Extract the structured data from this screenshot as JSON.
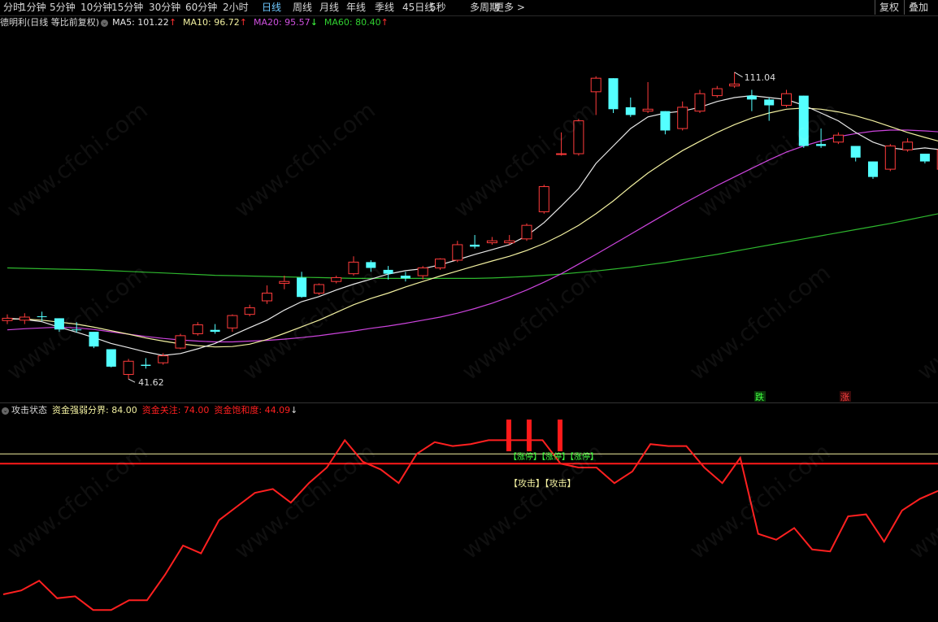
{
  "toolbar": {
    "tabs": [
      "分时",
      "1分钟",
      "5分钟",
      "10分钟",
      "15分钟",
      "30分钟",
      "60分钟",
      "2小时",
      "日线",
      "周线",
      "月线",
      "年线",
      "季线",
      "45日线",
      "5秒",
      "多周期",
      "更多 >"
    ],
    "active_tab": "日线",
    "right_buttons": [
      "复权",
      "叠加"
    ]
  },
  "main_legend": {
    "title": "德明利(日线 等比前复权)",
    "items": [
      {
        "label": "MA5: 101.22",
        "arrow": "↑",
        "color": "#e8e8e8",
        "arrow_color": "#ff3030"
      },
      {
        "label": "MA10: 96.72",
        "arrow": "↑",
        "color": "#f2f0a0",
        "arrow_color": "#ff3030"
      },
      {
        "label": "MA20: 95.57",
        "arrow": "↓",
        "color": "#d050e0",
        "arrow_color": "#40ff40"
      },
      {
        "label": "MA60: 80.40",
        "arrow": "↑",
        "color": "#30d030",
        "arrow_color": "#ff3030"
      }
    ]
  },
  "price_annotations": {
    "high": "111.04",
    "low": "41.62"
  },
  "signals": {
    "fall": "跌",
    "rise": "涨"
  },
  "sub_legend": {
    "title": "攻击状态",
    "items": [
      {
        "label": "资金强弱分界: 84.00",
        "color": "#f2f0a0"
      },
      {
        "label": "资金关注: 74.00",
        "color": "#ff2020"
      },
      {
        "label": "资金饱和度: 44.09",
        "color": "#ff2020"
      }
    ],
    "tail_arrow": "↓"
  },
  "sub_annotations": {
    "limit_up": "【涨停】【涨停】【涨停】",
    "attack": "【攻击】【攻击】"
  },
  "watermark": "www.cfchi.com",
  "colors": {
    "up": "#ff3b3b",
    "down": "#54ffff",
    "ma5": "#e8e8e8",
    "ma10": "#f2f0a0",
    "ma20": "#cc44dd",
    "ma60": "#2eb82e",
    "line": "#ff2020",
    "threshold_yellow": "#f2f0a0",
    "threshold_red": "#ff1a1a"
  },
  "chart_data": {
    "type": "candlestick",
    "title": "德明利(日线 等比前复权)",
    "candles": [
      {
        "o": 46.9,
        "h": 48.5,
        "l": 46.0,
        "c": 47.5
      },
      {
        "o": 47.0,
        "h": 48.8,
        "l": 46.0,
        "c": 47.8
      },
      {
        "o": 48.0,
        "h": 49.2,
        "l": 46.8,
        "c": 47.9
      },
      {
        "o": 47.5,
        "h": 47.5,
        "l": 44.0,
        "c": 44.6
      },
      {
        "o": 44.6,
        "h": 46.5,
        "l": 43.8,
        "c": 44.4
      },
      {
        "o": 44.0,
        "h": 44.0,
        "l": 39.8,
        "c": 40.2
      },
      {
        "o": 39.5,
        "h": 39.5,
        "l": 34.8,
        "c": 35.0
      },
      {
        "o": 33.0,
        "h": 37.0,
        "l": 31.8,
        "c": 36.4
      },
      {
        "o": 35.5,
        "h": 37.2,
        "l": 34.5,
        "c": 35.2
      },
      {
        "o": 36.0,
        "h": 38.5,
        "l": 35.5,
        "c": 37.8
      },
      {
        "o": 39.8,
        "h": 43.5,
        "l": 39.5,
        "c": 43.0
      },
      {
        "o": 43.5,
        "h": 46.5,
        "l": 43.0,
        "c": 45.8
      },
      {
        "o": 44.5,
        "h": 46.0,
        "l": 43.5,
        "c": 44.0
      },
      {
        "o": 45.0,
        "h": 48.5,
        "l": 44.0,
        "c": 48.2
      },
      {
        "o": 48.5,
        "h": 51.0,
        "l": 48.0,
        "c": 50.2
      },
      {
        "o": 52.0,
        "h": 56.0,
        "l": 51.2,
        "c": 54.0
      },
      {
        "o": 56.5,
        "h": 58.5,
        "l": 55.0,
        "c": 57.0
      },
      {
        "o": 58.0,
        "h": 59.5,
        "l": 52.8,
        "c": 53.0
      },
      {
        "o": 54.0,
        "h": 56.5,
        "l": 53.5,
        "c": 56.2
      },
      {
        "o": 57.0,
        "h": 58.5,
        "l": 56.5,
        "c": 58.0
      },
      {
        "o": 59.0,
        "h": 63.5,
        "l": 58.5,
        "c": 62.0
      },
      {
        "o": 62.0,
        "h": 62.5,
        "l": 59.5,
        "c": 60.5
      },
      {
        "o": 60.0,
        "h": 61.0,
        "l": 57.5,
        "c": 59.0
      },
      {
        "o": 58.5,
        "h": 59.5,
        "l": 57.0,
        "c": 57.8
      },
      {
        "o": 58.5,
        "h": 61.0,
        "l": 57.5,
        "c": 60.5
      },
      {
        "o": 60.5,
        "h": 63.0,
        "l": 60.0,
        "c": 62.8
      },
      {
        "o": 62.5,
        "h": 67.5,
        "l": 62.0,
        "c": 66.5
      },
      {
        "o": 66.5,
        "h": 69.0,
        "l": 65.5,
        "c": 66.0
      },
      {
        "o": 67.0,
        "h": 68.5,
        "l": 66.5,
        "c": 67.5
      },
      {
        "o": 67.0,
        "h": 69.0,
        "l": 66.5,
        "c": 67.5
      },
      {
        "o": 68.0,
        "h": 72.0,
        "l": 67.5,
        "c": 71.5
      },
      {
        "o": 75.0,
        "h": 82.0,
        "l": 74.5,
        "c": 81.5
      },
      {
        "o": 90.0,
        "h": 95.5,
        "l": 89.5,
        "c": 90.0
      },
      {
        "o": 90.0,
        "h": 99.0,
        "l": 89.5,
        "c": 98.5
      },
      {
        "o": 106.0,
        "h": 110.0,
        "l": 100.0,
        "c": 109.5
      },
      {
        "o": 109.5,
        "h": 109.5,
        "l": 100.5,
        "c": 101.5
      },
      {
        "o": 102.0,
        "h": 104.5,
        "l": 99.5,
        "c": 100.0
      },
      {
        "o": 101.0,
        "h": 108.5,
        "l": 100.5,
        "c": 101.5
      },
      {
        "o": 101.0,
        "h": 101.0,
        "l": 95.0,
        "c": 96.0
      },
      {
        "o": 96.5,
        "h": 103.5,
        "l": 96.0,
        "c": 102.0
      },
      {
        "o": 101.0,
        "h": 106.5,
        "l": 100.5,
        "c": 105.5
      },
      {
        "o": 105.0,
        "h": 107.5,
        "l": 104.5,
        "c": 106.8
      },
      {
        "o": 107.5,
        "h": 111.04,
        "l": 107.0,
        "c": 108.0
      },
      {
        "o": 105.0,
        "h": 106.5,
        "l": 101.0,
        "c": 104.0
      },
      {
        "o": 104.0,
        "h": 104.5,
        "l": 98.5,
        "c": 102.5
      },
      {
        "o": 102.5,
        "h": 106.5,
        "l": 102.0,
        "c": 105.5
      },
      {
        "o": 105.0,
        "h": 105.0,
        "l": 91.5,
        "c": 92.0
      },
      {
        "o": 92.5,
        "h": 96.5,
        "l": 91.5,
        "c": 92.0
      },
      {
        "o": 93.0,
        "h": 95.5,
        "l": 92.5,
        "c": 94.8
      },
      {
        "o": 92.0,
        "h": 92.0,
        "l": 88.0,
        "c": 89.0
      },
      {
        "o": 88.0,
        "h": 88.0,
        "l": 83.5,
        "c": 84.0
      },
      {
        "o": 86.0,
        "h": 92.5,
        "l": 85.5,
        "c": 92.0
      },
      {
        "o": 91.0,
        "h": 94.0,
        "l": 90.5,
        "c": 93.0
      },
      {
        "o": 90.0,
        "h": 90.0,
        "l": 87.5,
        "c": 88.0
      },
      {
        "o": 86.0,
        "h": 91.5,
        "l": 85.0,
        "c": 91.0
      },
      {
        "o": 93.5,
        "h": 95.5,
        "l": 92.5,
        "c": 93.0
      },
      {
        "o": 93.0,
        "h": 95.5,
        "l": 92.5,
        "c": 94.0
      }
    ],
    "ma5": [
      47.5,
      47.2,
      46.6,
      45.2,
      43.9,
      42.5,
      41.0,
      39.9,
      38.8,
      37.9,
      38.4,
      39.6,
      41.0,
      43.1,
      45.1,
      47.0,
      49.6,
      51.8,
      53.1,
      54.8,
      56.3,
      57.6,
      58.9,
      59.8,
      60.3,
      61.3,
      62.6,
      64.0,
      65.2,
      66.5,
      68.8,
      72.2,
      76.5,
      81.0,
      87.5,
      92.0,
      96.5,
      99.5,
      100.5,
      101.0,
      102.0,
      103.5,
      104.5,
      105.0,
      104.5,
      104.0,
      102.5,
      100.5,
      98.5,
      95.5,
      93.0,
      91.5,
      91.0,
      91.5,
      91.0,
      92.0,
      93.0
    ],
    "ma10": [
      47.3,
      47.3,
      47.0,
      46.5,
      46.0,
      45.2,
      44.3,
      43.4,
      42.4,
      41.6,
      40.9,
      40.4,
      40.1,
      40.2,
      40.8,
      42.0,
      43.6,
      45.3,
      47.0,
      49.0,
      51.0,
      52.6,
      54.0,
      55.6,
      57.0,
      58.4,
      59.7,
      61.0,
      62.3,
      63.5,
      65.0,
      66.8,
      69.0,
      71.5,
      74.5,
      77.8,
      81.5,
      85.0,
      88.0,
      90.8,
      93.2,
      95.5,
      97.5,
      99.2,
      100.5,
      101.5,
      101.8,
      101.5,
      100.8,
      99.8,
      98.5,
      97.0,
      95.5,
      94.2,
      93.0,
      92.3,
      92.8
    ],
    "ma20": [
      44.5,
      44.8,
      45.0,
      45.2,
      45.0,
      44.6,
      44.0,
      43.4,
      42.8,
      42.3,
      41.9,
      41.6,
      41.4,
      41.4,
      41.6,
      41.8,
      42.1,
      42.5,
      43.0,
      43.6,
      44.2,
      44.9,
      45.5,
      46.2,
      47.0,
      47.8,
      48.8,
      50.0,
      51.4,
      53.0,
      54.8,
      56.8,
      59.0,
      61.5,
      64.0,
      66.6,
      69.2,
      71.8,
      74.4,
      77.0,
      79.4,
      81.8,
      84.0,
      86.2,
      88.4,
      90.4,
      92.0,
      93.3,
      94.4,
      95.2,
      95.8,
      96.1,
      96.1,
      95.9,
      95.6,
      95.5,
      95.6
    ],
    "ma60": [
      60.5,
      60.4,
      60.3,
      60.2,
      60.1,
      60.0,
      59.8,
      59.6,
      59.4,
      59.2,
      59.0,
      58.8,
      58.6,
      58.5,
      58.4,
      58.3,
      58.2,
      58.1,
      58.0,
      57.9,
      57.8,
      57.8,
      57.8,
      57.8,
      57.8,
      57.8,
      57.8,
      57.8,
      57.9,
      58.1,
      58.3,
      58.6,
      58.9,
      59.3,
      59.7,
      60.2,
      60.7,
      61.3,
      61.9,
      62.6,
      63.3,
      64.0,
      64.8,
      65.6,
      66.4,
      67.2,
      68.0,
      68.8,
      69.6,
      70.4,
      71.2,
      72.0,
      72.9,
      73.8,
      74.7,
      75.7,
      76.8
    ],
    "sub_series": {
      "name": "资金饱和度",
      "values": [
        5,
        7,
        12,
        3,
        4,
        -3,
        -3,
        2,
        2,
        15,
        30,
        26,
        43,
        50,
        57,
        59,
        52,
        62,
        70,
        84,
        73,
        69,
        62,
        77,
        83,
        81,
        82,
        84,
        84,
        84,
        84,
        72,
        70,
        70,
        62,
        68,
        82,
        81,
        81,
        70,
        62,
        75,
        36,
        33,
        39,
        28,
        27,
        45,
        46,
        32,
        48,
        54,
        58
      ]
    },
    "sub_ylim": [
      -5,
      95
    ],
    "thresholds": {
      "yellow": 77,
      "red": 72
    },
    "ylim": [
      31,
      115
    ]
  }
}
